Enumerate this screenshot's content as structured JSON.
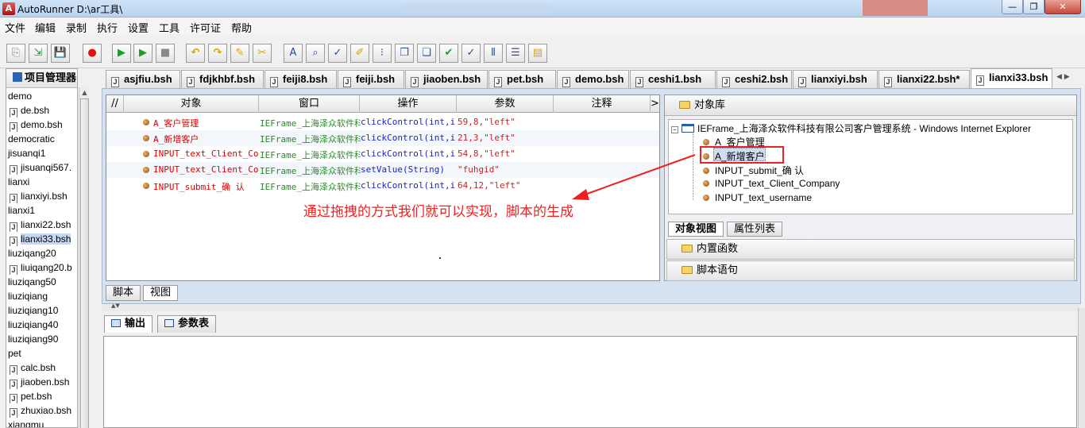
{
  "window": {
    "title": "AutoRunner  D:\\ar工具\\",
    "minimize": "—",
    "maximize": "❐",
    "close": "✕"
  },
  "menu": [
    "文件",
    "编辑",
    "录制",
    "执行",
    "设置",
    "工具",
    "许可证",
    "帮助"
  ],
  "toolbar_icons": [
    {
      "name": "new-project-icon",
      "glyph": "⎘",
      "tone": "gray"
    },
    {
      "name": "import-icon",
      "glyph": "⇲",
      "tone": "green"
    },
    {
      "name": "save-icon",
      "glyph": "💾",
      "tone": "gray"
    },
    {
      "name": "record-icon",
      "glyph": "●",
      "tone": "red"
    },
    {
      "name": "run-icon",
      "glyph": "▶",
      "tone": "green"
    },
    {
      "name": "step-run-icon",
      "glyph": "▶",
      "tone": "green"
    },
    {
      "name": "stop-icon",
      "glyph": "■",
      "tone": "gray"
    },
    {
      "name": "undo-icon",
      "glyph": "↶",
      "tone": "yellow"
    },
    {
      "name": "redo-icon",
      "glyph": "↷",
      "tone": "yellow"
    },
    {
      "name": "pencil-icon",
      "glyph": "✎",
      "tone": "yellow"
    },
    {
      "name": "tools-icon",
      "glyph": "✂",
      "tone": "yellow"
    },
    {
      "name": "text-icon",
      "glyph": "A",
      "tone": "blue"
    },
    {
      "name": "find-icon",
      "glyph": "⌕",
      "tone": "blue"
    },
    {
      "name": "check-icon",
      "glyph": "✓",
      "tone": "blue"
    },
    {
      "name": "edit-object-icon",
      "glyph": "✐",
      "tone": "yellow"
    },
    {
      "name": "breakpoint-icon",
      "glyph": "⁝",
      "tone": "blue"
    },
    {
      "name": "copy-icon",
      "glyph": "❐",
      "tone": "blue"
    },
    {
      "name": "paste-icon",
      "glyph": "❏",
      "tone": "blue"
    },
    {
      "name": "validate-icon",
      "glyph": "✔",
      "tone": "green"
    },
    {
      "name": "verify-icon",
      "glyph": "✓",
      "tone": "blue"
    },
    {
      "name": "columns-icon",
      "glyph": "⦀",
      "tone": "blue"
    },
    {
      "name": "comment-icon",
      "glyph": "☰",
      "tone": "blue"
    },
    {
      "name": "report-icon",
      "glyph": "▤",
      "tone": "yellow"
    }
  ],
  "project_panel": {
    "title": "项目管理器",
    "tree": [
      {
        "label": "demo",
        "kind": "folder"
      },
      {
        "label": "de.bsh",
        "kind": "file"
      },
      {
        "label": "demo.bsh",
        "kind": "file"
      },
      {
        "label": "democratic",
        "kind": "folder"
      },
      {
        "label": "jisuanqi1",
        "kind": "folder"
      },
      {
        "label": "jisuanqi567.",
        "kind": "file"
      },
      {
        "label": "lianxi",
        "kind": "folder"
      },
      {
        "label": "lianxiyi.bsh",
        "kind": "file"
      },
      {
        "label": "lianxi1",
        "kind": "folder"
      },
      {
        "label": "lianxi22.bsh",
        "kind": "file"
      },
      {
        "label": "lianxi33.bsh",
        "kind": "file",
        "selected": true
      },
      {
        "label": "liuziqang20",
        "kind": "folder"
      },
      {
        "label": "liuiqang20.b",
        "kind": "file"
      },
      {
        "label": "liuziqang50",
        "kind": "folder"
      },
      {
        "label": "liuziqiang",
        "kind": "folder"
      },
      {
        "label": "liuziqiang10",
        "kind": "folder"
      },
      {
        "label": "liuziqiang40",
        "kind": "folder"
      },
      {
        "label": "liuziqiang90",
        "kind": "folder"
      },
      {
        "label": "pet",
        "kind": "folder"
      },
      {
        "label": "calc.bsh",
        "kind": "file"
      },
      {
        "label": "jiaoben.bsh",
        "kind": "file"
      },
      {
        "label": "pet.bsh",
        "kind": "file"
      },
      {
        "label": "zhuxiao.bsh",
        "kind": "file"
      },
      {
        "label": "xiangmu",
        "kind": "folder"
      }
    ]
  },
  "editor_tabs": [
    "asjfiu.bsh",
    "fdjkhbf.bsh",
    "feiji8.bsh",
    "feiji.bsh",
    "jiaoben.bsh",
    "pet.bsh",
    "demo.bsh",
    "ceshi1.bsh",
    "ceshi2.bsh",
    "lianxiyi.bsh",
    "lianxi22.bsh*",
    "lianxi33.bsh"
  ],
  "active_tab": "lianxi33.bsh",
  "grid": {
    "columns": [
      "//",
      "对象",
      "窗口",
      "操作",
      "参数",
      "注释",
      ">"
    ],
    "rows": [
      {
        "object": "A_客户管理",
        "window": "IEFrame_上海泽众软件科",
        "action": "clickControl(int,int",
        "params": "59,8,\"left\""
      },
      {
        "object": "A_新增客户",
        "window": "IEFrame_上海泽众软件科",
        "action": "clickControl(int,int",
        "params": "21,3,\"left\""
      },
      {
        "object": "INPUT_text_Client_Comp",
        "window": "IEFrame_上海泽众软件科",
        "action": "clickControl(int,int",
        "params": "54,8,\"left\""
      },
      {
        "object": "INPUT_text_Client_Comp",
        "window": "IEFrame_上海泽众软件科",
        "action": "setValue(String)",
        "params": "\"fuhgid\""
      },
      {
        "object": "INPUT_submit_确  认",
        "window": "IEFrame_上海泽众软件科",
        "action": "clickControl(int,int",
        "params": "64,12,\"left\""
      }
    ]
  },
  "annotation": "通过拖拽的方式我们就可以实现，脚本的生成",
  "object_library": {
    "title": "对象库",
    "root": "IEFrame_上海泽众软件科技有限公司客户管理系统 - Windows Internet Explorer",
    "children": [
      "A_客户管理",
      "A_新增客户",
      "INPUT_submit_确  认",
      "INPUT_text_Client_Company",
      "INPUT_text_username"
    ],
    "selected": "A_新增客户",
    "tabs": [
      "对象视图",
      "属性列表"
    ],
    "sections": [
      "内置函数",
      "脚本语句"
    ]
  },
  "view_tabs": [
    "脚本",
    "视图"
  ],
  "output_tabs": [
    "输出",
    "参数表"
  ],
  "colors": {
    "annotation": "#f02020",
    "object_text": "#dd0000",
    "window_text": "#2a8a2a",
    "action_text": "#1a22cc"
  }
}
